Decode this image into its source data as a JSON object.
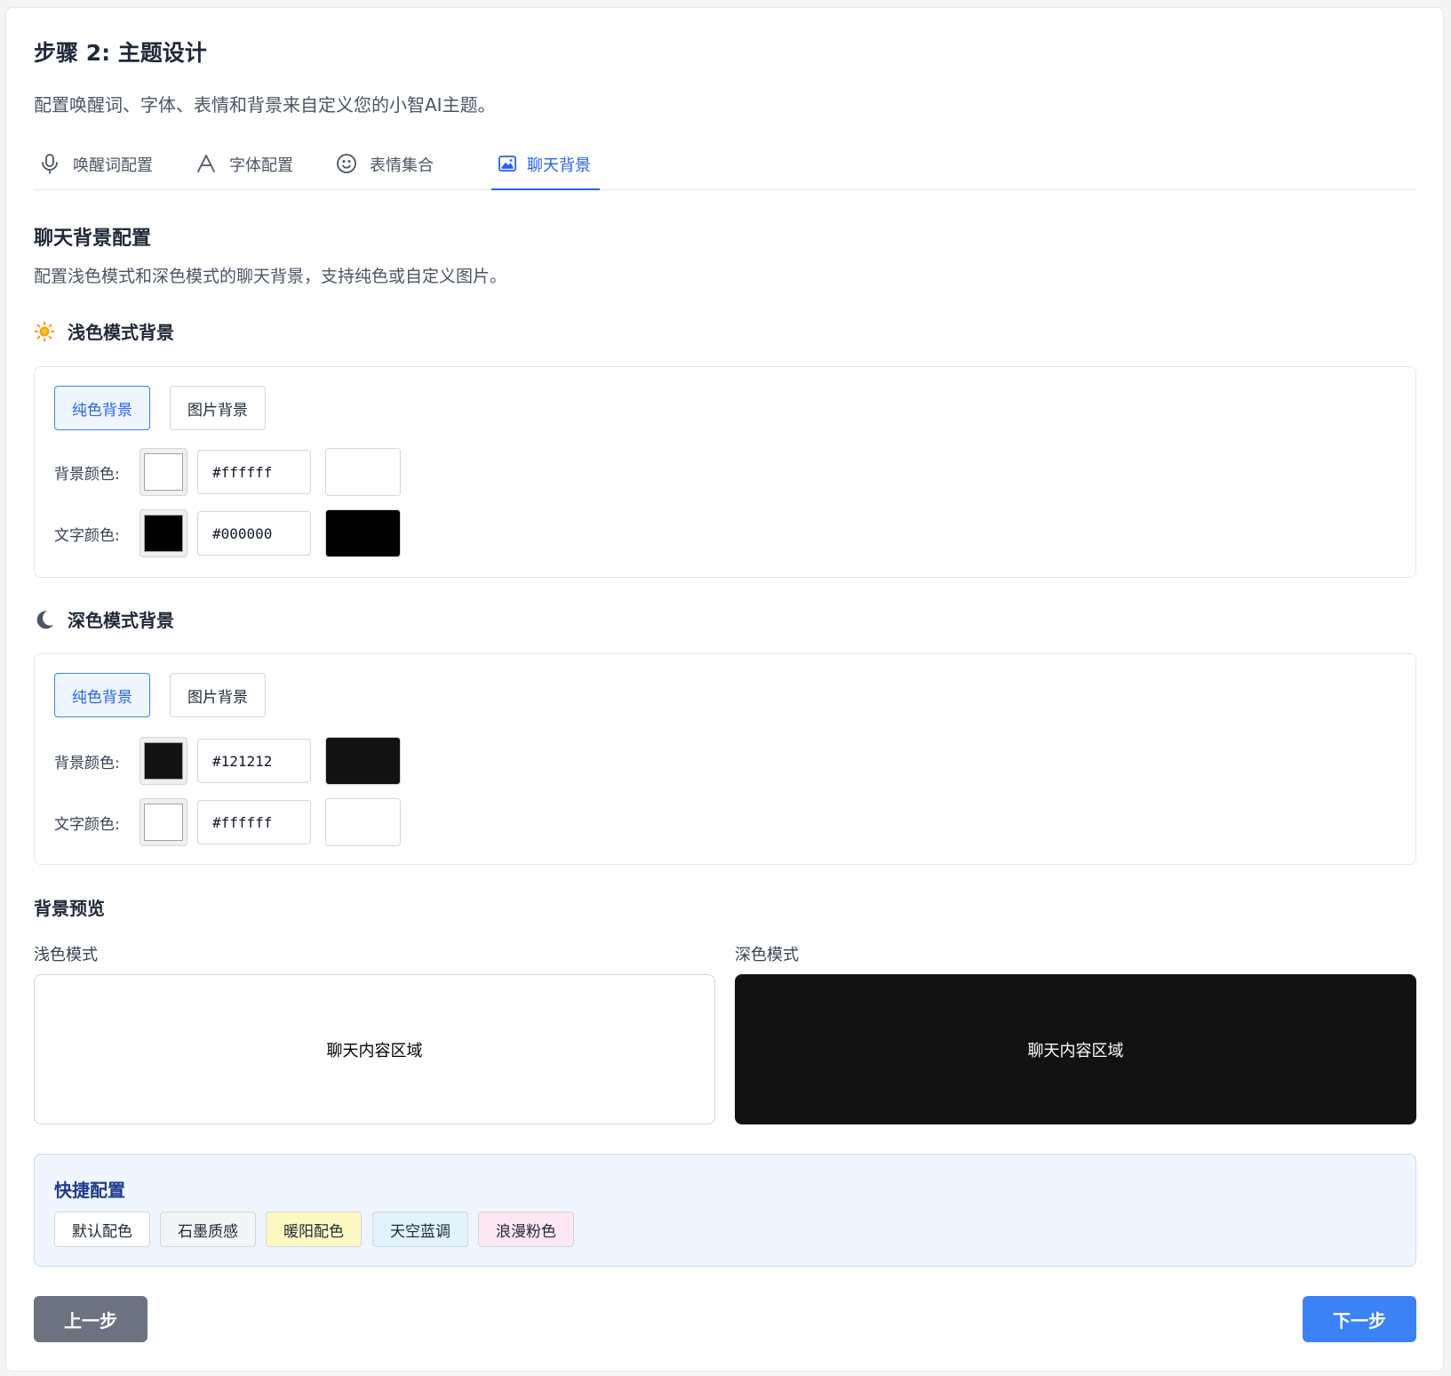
{
  "header": {
    "title": "步骤 2: 主题设计",
    "description": "配置唤醒词、字体、表情和背景来自定义您的小智AI主题。"
  },
  "tabs": [
    {
      "label": "唤醒词配置",
      "icon": "microphone-icon",
      "active": false
    },
    {
      "label": "字体配置",
      "icon": "font-icon",
      "active": false
    },
    {
      "label": "表情集合",
      "icon": "smiley-icon",
      "active": false
    },
    {
      "label": "聊天背景",
      "icon": "image-icon",
      "active": true
    }
  ],
  "section": {
    "title": "聊天背景配置",
    "description": "配置浅色模式和深色模式的聊天背景，支持纯色或自定义图片。"
  },
  "light_mode": {
    "heading": "浅色模式背景",
    "icon": "sun-icon",
    "solid_label": "纯色背景",
    "image_label": "图片背景",
    "selected": "纯色背景",
    "bg_label": "背景颜色:",
    "bg_color": "#ffffff",
    "text_label": "文字颜色:",
    "text_color": "#000000"
  },
  "dark_mode": {
    "heading": "深色模式背景",
    "icon": "moon-icon",
    "solid_label": "纯色背景",
    "image_label": "图片背景",
    "selected": "纯色背景",
    "bg_label": "背景颜色:",
    "bg_color": "#121212",
    "text_label": "文字颜色:",
    "text_color": "#ffffff"
  },
  "preview": {
    "title": "背景预览",
    "light_label": "浅色模式",
    "dark_label": "深色模式",
    "content_text": "聊天内容区域"
  },
  "quick_config": {
    "title": "快捷配置",
    "presets": [
      {
        "label": "默认配色",
        "color": "#ffffff"
      },
      {
        "label": "石墨质感",
        "color": "#f3f4f6"
      },
      {
        "label": "暖阳配色",
        "color": "#fef9c3"
      },
      {
        "label": "天空蓝调",
        "color": "#e0f2fe"
      },
      {
        "label": "浪漫粉色",
        "color": "#fce7f3"
      }
    ]
  },
  "nav": {
    "prev_label": "上一步",
    "next_label": "下一步"
  },
  "colors": {
    "accent": "#3b82f6",
    "accent_text": "#2563eb",
    "prev_button": "#6b7280"
  }
}
